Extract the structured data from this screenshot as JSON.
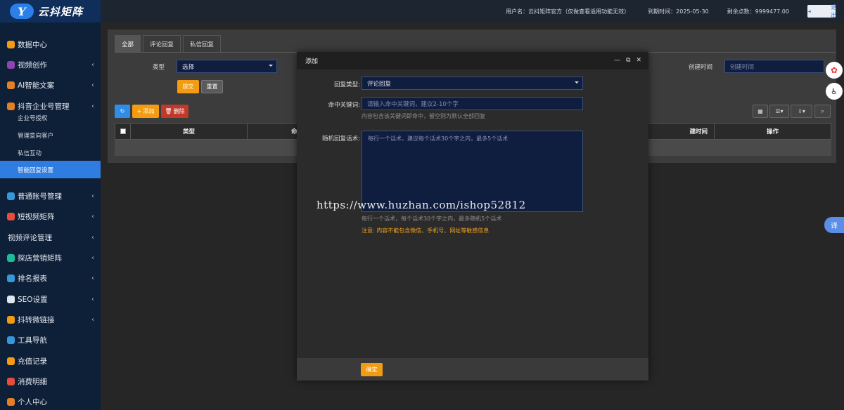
{
  "app": {
    "logo_mark": "Y",
    "name": "云抖矩阵"
  },
  "topbar": {
    "username": "用户名：云抖矩阵官方（仅做查看适用功能无效）",
    "expire": "到期时间：2025-05-30",
    "points": "剩余点数：9999477.00",
    "logout": "退出"
  },
  "sidebar": {
    "items": [
      {
        "label": "数据中心",
        "icon": "dashboard-icon",
        "color": "#f39c12",
        "arrow": false
      },
      {
        "label": "视频创作",
        "icon": "video-icon",
        "color": "#8e44ad",
        "arrow": true
      },
      {
        "label": "AI智能文案",
        "icon": "ai-icon",
        "color": "#e67e22",
        "arrow": true
      },
      {
        "label": "抖音企业号管理",
        "icon": "enterprise-icon",
        "color": "#e67e22",
        "arrow": true
      },
      {
        "label": "普通账号管理",
        "icon": "account-icon",
        "color": "#3498db",
        "arrow": true
      },
      {
        "label": "短视频矩阵",
        "icon": "short-video-icon",
        "color": "#e74c3c",
        "arrow": true
      },
      {
        "label": "视频评论管理",
        "icon": "",
        "color": "",
        "arrow": true
      },
      {
        "label": "探店营销矩阵",
        "icon": "store-icon",
        "color": "#1abc9c",
        "arrow": true
      },
      {
        "label": "排名报表",
        "icon": "ranking-icon",
        "color": "#3498db",
        "arrow": true
      },
      {
        "label": "SEO设置",
        "icon": "seo-icon",
        "color": "#dfe6ee",
        "arrow": true
      },
      {
        "label": "抖转微链接",
        "icon": "link-icon",
        "color": "#f39c12",
        "arrow": true
      },
      {
        "label": "工具导航",
        "icon": "tools-icon",
        "color": "#3498db",
        "arrow": false
      },
      {
        "label": "充值记录",
        "icon": "recharge-icon",
        "color": "#f39c12",
        "arrow": false
      },
      {
        "label": "消费明细",
        "icon": "consume-icon",
        "color": "#e74c3c",
        "arrow": false
      },
      {
        "label": "个人中心",
        "icon": "user-icon",
        "color": "#e67e22",
        "arrow": false
      }
    ],
    "subitems": [
      "企业号授权",
      "管理意向客户",
      "私信互动",
      "智能回复设置"
    ]
  },
  "page": {
    "tabs": [
      "全部",
      "评论回复",
      "私信回复"
    ],
    "filter_type_label": "类型",
    "filter_type_value": "选择",
    "filter_time_label": "创建时间",
    "filter_time_placeholder": "创建时间",
    "submit": "提交",
    "reset": "重置",
    "add": "添加",
    "delete": "删除",
    "columns": [
      "类型",
      "命",
      "建时间",
      "操作"
    ]
  },
  "modal": {
    "title": "添加",
    "reply_type_label": "回复类型:",
    "reply_type_value": "评论回复",
    "keyword_label": "命中关键词:",
    "keyword_placeholder": "请输入命中关键词，建议2-10个字",
    "keyword_hint": "内容包含该关键词即命中，留空则为默认全部回复",
    "random_label": "随机回复话术:",
    "random_placeholder": "每行一个话术，建议每个话术30个字之内，最多5个话术",
    "random_hint": "每行一个话术，每个话术30个字之内，最多随机5个话术",
    "warning": "注意: 内容不能包含微信、手机号、网址等敏感信息",
    "confirm": "确定"
  },
  "watermark": "https://www.huzhan.com/ishop52812",
  "floating": {
    "translate": "译"
  }
}
